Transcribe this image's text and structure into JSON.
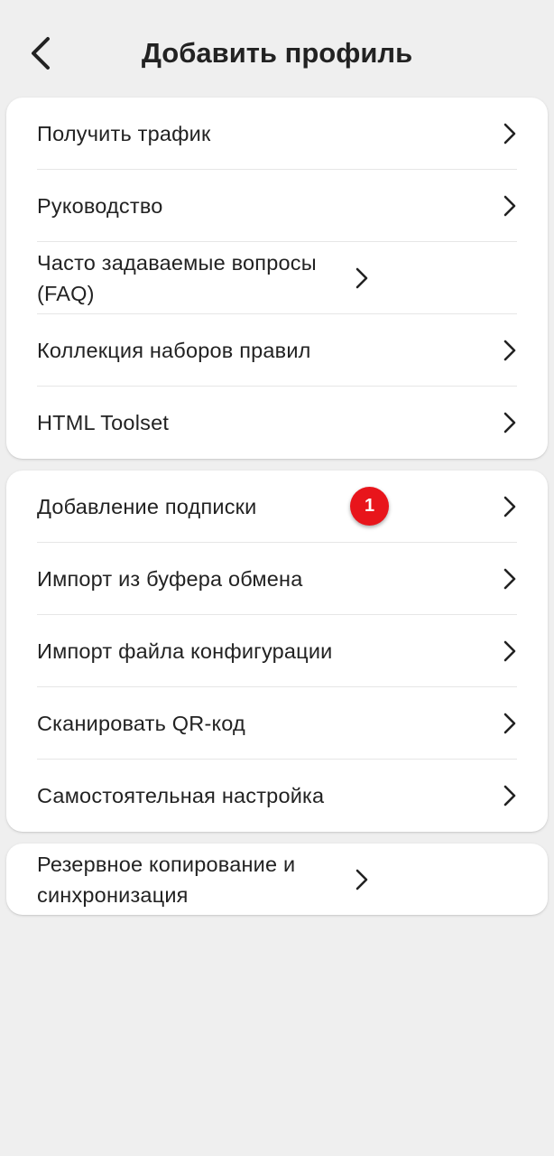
{
  "header": {
    "title": "Добавить профиль"
  },
  "group1": {
    "items": [
      {
        "label": "Получить трафик"
      },
      {
        "label": "Руководство"
      },
      {
        "label": "Часто задаваемые вопросы (FAQ)"
      },
      {
        "label": "Коллекция наборов правил"
      },
      {
        "label": "HTML Toolset"
      }
    ]
  },
  "group2": {
    "items": [
      {
        "label": "Добавление подписки",
        "badge": "1"
      },
      {
        "label": "Импорт из буфера обмена"
      },
      {
        "label": "Импорт файла конфигурации"
      },
      {
        "label": "Сканировать QR-код"
      },
      {
        "label": "Самостоятельная настройка"
      }
    ]
  },
  "group3": {
    "items": [
      {
        "label": "Резервное копирование и синхронизация"
      }
    ]
  },
  "colors": {
    "background": "#efefef",
    "card": "#ffffff",
    "badge": "#e8151b",
    "text": "#222222"
  }
}
